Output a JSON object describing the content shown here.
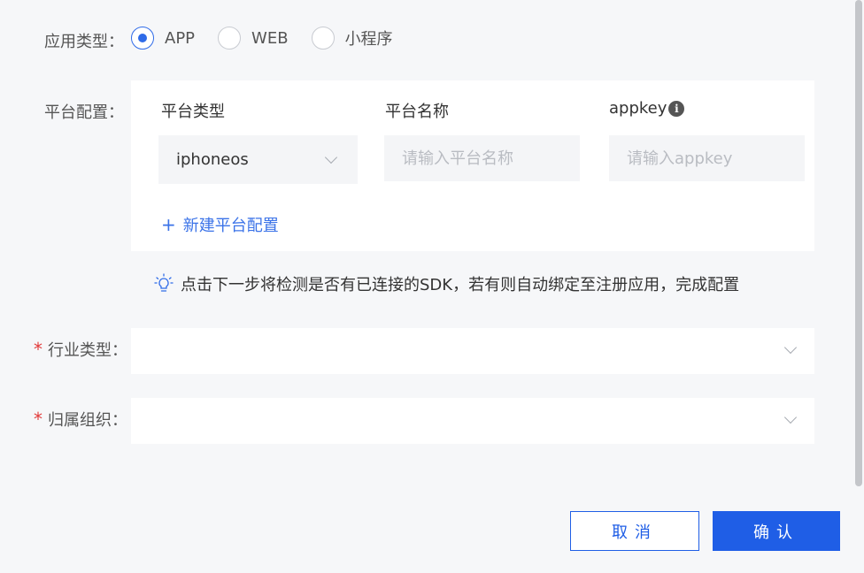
{
  "app_type": {
    "label": "应用类型：",
    "options": [
      {
        "label": "APP",
        "selected": true
      },
      {
        "label": "WEB",
        "selected": false
      },
      {
        "label": "小程序",
        "selected": false
      }
    ]
  },
  "platform_config": {
    "label": "平台配置：",
    "columns": {
      "type": "平台类型",
      "name": "平台名称",
      "appkey": "appkey"
    },
    "info_icon": "i",
    "type_value": "iphoneos",
    "name_placeholder": "请输入平台名称",
    "appkey_placeholder": "请输入appkey",
    "add_label": "新建平台配置",
    "add_symbol": "+"
  },
  "tip": "点击下一步将检测是否有已连接的SDK，若有则自动绑定至注册应用，完成配置",
  "industry": {
    "required_mark": "*",
    "label": "行业类型："
  },
  "organization": {
    "required_mark": "*",
    "label": "归属组织："
  },
  "footer": {
    "cancel": "取消",
    "confirm": "确认"
  },
  "colors": {
    "accent": "#1f5ee6",
    "required": "#e23a3a",
    "link": "#3b73e8"
  }
}
